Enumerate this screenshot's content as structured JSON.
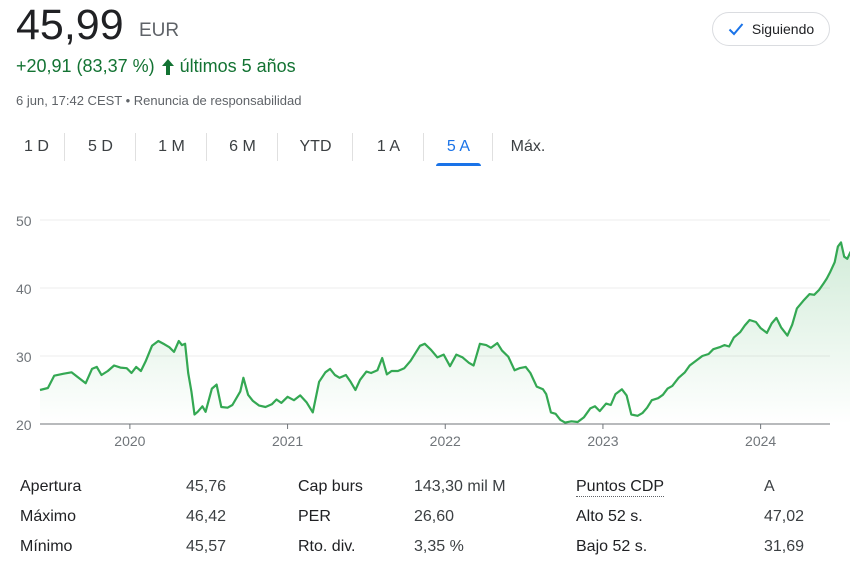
{
  "quote": {
    "price": "45,99",
    "currency": "EUR",
    "change": "+20,91 (83,37 %)",
    "period": "últimos 5 años",
    "timestamp": "6 jun, 17:42 CEST",
    "separator": " • ",
    "disclaimer": "Renuncia de responsabilidad"
  },
  "follow_button": {
    "label": "Siguiendo"
  },
  "tabs": [
    {
      "label": "1 D",
      "active": false
    },
    {
      "label": "5 D",
      "active": false
    },
    {
      "label": "1 M",
      "active": false
    },
    {
      "label": "6 M",
      "active": false
    },
    {
      "label": "YTD",
      "active": false
    },
    {
      "label": "1 A",
      "active": false
    },
    {
      "label": "5 A",
      "active": true
    },
    {
      "label": "Máx.",
      "active": false
    }
  ],
  "colors": {
    "up": "#137333",
    "line": "#34a853",
    "accent": "#1a73e8"
  },
  "chart_data": {
    "type": "area",
    "x_ticks": [
      "2020",
      "2021",
      "2022",
      "2023",
      "2024"
    ],
    "y_ticks": [
      "50",
      "40",
      "30",
      "20"
    ],
    "ylim": [
      20,
      50
    ],
    "xlim": [
      2019.43,
      2024.44
    ],
    "grid": true,
    "series": [
      {
        "values": [
          [
            2019.43,
            25.0
          ],
          [
            2019.48,
            25.3
          ],
          [
            2019.52,
            27.1
          ],
          [
            2019.58,
            27.4
          ],
          [
            2019.63,
            27.6
          ],
          [
            2019.68,
            26.7
          ],
          [
            2019.72,
            26.0
          ],
          [
            2019.76,
            28.1
          ],
          [
            2019.79,
            28.4
          ],
          [
            2019.82,
            27.2
          ],
          [
            2019.86,
            27.8
          ],
          [
            2019.9,
            28.6
          ],
          [
            2019.94,
            28.3
          ],
          [
            2019.98,
            28.2
          ],
          [
            2020.01,
            27.5
          ],
          [
            2020.04,
            28.4
          ],
          [
            2020.07,
            27.8
          ],
          [
            2020.1,
            29.2
          ],
          [
            2020.14,
            31.5
          ],
          [
            2020.18,
            32.2
          ],
          [
            2020.22,
            31.7
          ],
          [
            2020.25,
            31.3
          ],
          [
            2020.28,
            30.6
          ],
          [
            2020.31,
            32.2
          ],
          [
            2020.33,
            31.6
          ],
          [
            2020.35,
            31.8
          ],
          [
            2020.37,
            27.5
          ],
          [
            2020.39,
            24.8
          ],
          [
            2020.41,
            21.4
          ],
          [
            2020.43,
            21.8
          ],
          [
            2020.46,
            22.6
          ],
          [
            2020.48,
            21.8
          ],
          [
            2020.52,
            25.2
          ],
          [
            2020.55,
            25.8
          ],
          [
            2020.58,
            22.5
          ],
          [
            2020.62,
            22.4
          ],
          [
            2020.65,
            22.8
          ],
          [
            2020.7,
            24.8
          ],
          [
            2020.72,
            26.8
          ],
          [
            2020.75,
            24.3
          ],
          [
            2020.78,
            23.4
          ],
          [
            2020.82,
            22.7
          ],
          [
            2020.86,
            22.5
          ],
          [
            2020.9,
            22.9
          ],
          [
            2020.93,
            23.6
          ],
          [
            2020.96,
            23.1
          ],
          [
            2021.0,
            24.0
          ],
          [
            2021.04,
            23.5
          ],
          [
            2021.08,
            24.2
          ],
          [
            2021.12,
            23.2
          ],
          [
            2021.16,
            21.7
          ],
          [
            2021.2,
            26.2
          ],
          [
            2021.24,
            27.6
          ],
          [
            2021.27,
            28.1
          ],
          [
            2021.3,
            27.2
          ],
          [
            2021.33,
            26.8
          ],
          [
            2021.37,
            27.2
          ],
          [
            2021.4,
            26.2
          ],
          [
            2021.43,
            25.0
          ],
          [
            2021.46,
            26.5
          ],
          [
            2021.5,
            27.7
          ],
          [
            2021.53,
            27.5
          ],
          [
            2021.57,
            27.9
          ],
          [
            2021.6,
            29.7
          ],
          [
            2021.63,
            27.3
          ],
          [
            2021.66,
            27.8
          ],
          [
            2021.7,
            27.8
          ],
          [
            2021.74,
            28.2
          ],
          [
            2021.78,
            29.3
          ],
          [
            2021.81,
            30.4
          ],
          [
            2021.84,
            31.5
          ],
          [
            2021.87,
            31.8
          ],
          [
            2021.91,
            30.9
          ],
          [
            2021.95,
            29.8
          ],
          [
            2021.99,
            30.2
          ],
          [
            2022.03,
            28.5
          ],
          [
            2022.07,
            30.2
          ],
          [
            2022.11,
            29.8
          ],
          [
            2022.15,
            29.0
          ],
          [
            2022.18,
            28.6
          ],
          [
            2022.22,
            31.8
          ],
          [
            2022.26,
            31.6
          ],
          [
            2022.29,
            31.2
          ],
          [
            2022.33,
            31.9
          ],
          [
            2022.36,
            30.8
          ],
          [
            2022.4,
            29.9
          ],
          [
            2022.44,
            27.9
          ],
          [
            2022.47,
            28.2
          ],
          [
            2022.51,
            28.4
          ],
          [
            2022.54,
            27.5
          ],
          [
            2022.58,
            25.5
          ],
          [
            2022.62,
            25.1
          ],
          [
            2022.64,
            24.4
          ],
          [
            2022.67,
            21.7
          ],
          [
            2022.7,
            21.5
          ],
          [
            2022.73,
            20.6
          ],
          [
            2022.76,
            20.2
          ],
          [
            2022.8,
            20.4
          ],
          [
            2022.84,
            20.3
          ],
          [
            2022.88,
            21.0
          ],
          [
            2022.92,
            22.3
          ],
          [
            2022.95,
            22.6
          ],
          [
            2022.98,
            21.9
          ],
          [
            2023.02,
            23.0
          ],
          [
            2023.05,
            22.8
          ],
          [
            2023.08,
            24.4
          ],
          [
            2023.12,
            25.1
          ],
          [
            2023.15,
            24.2
          ],
          [
            2023.18,
            21.4
          ],
          [
            2023.22,
            21.2
          ],
          [
            2023.25,
            21.6
          ],
          [
            2023.28,
            22.4
          ],
          [
            2023.31,
            23.5
          ],
          [
            2023.35,
            23.8
          ],
          [
            2023.38,
            24.3
          ],
          [
            2023.41,
            25.2
          ],
          [
            2023.44,
            25.6
          ],
          [
            2023.48,
            26.8
          ],
          [
            2023.52,
            27.6
          ],
          [
            2023.55,
            28.6
          ],
          [
            2023.59,
            29.3
          ],
          [
            2023.63,
            30.0
          ],
          [
            2023.67,
            30.3
          ],
          [
            2023.7,
            31.0
          ],
          [
            2023.74,
            31.3
          ],
          [
            2023.77,
            31.6
          ],
          [
            2023.8,
            31.4
          ],
          [
            2023.83,
            32.7
          ],
          [
            2023.87,
            33.5
          ],
          [
            2023.9,
            34.5
          ],
          [
            2023.93,
            35.3
          ],
          [
            2023.97,
            35.0
          ],
          [
            2024.0,
            34.1
          ],
          [
            2024.04,
            33.4
          ],
          [
            2024.07,
            34.8
          ],
          [
            2024.1,
            35.6
          ],
          [
            2024.13,
            34.2
          ],
          [
            2024.17,
            33.0
          ],
          [
            2024.2,
            34.6
          ],
          [
            2024.23,
            37.0
          ],
          [
            2024.27,
            38.1
          ],
          [
            2024.31,
            39.1
          ],
          [
            2024.34,
            39.0
          ],
          [
            2024.37,
            39.7
          ],
          [
            2024.4,
            40.7
          ],
          [
            2024.42,
            41.4
          ],
          [
            2024.44,
            42.3
          ],
          [
            2024.47,
            43.8
          ],
          [
            2024.49,
            46.1
          ],
          [
            2024.51,
            46.7
          ],
          [
            2024.53,
            44.6
          ],
          [
            2024.55,
            44.3
          ],
          [
            2024.57,
            45.3
          ],
          [
            2024.59,
            43.2
          ],
          [
            2024.61,
            43.1
          ],
          [
            2024.63,
            43.7
          ],
          [
            2024.65,
            44.6
          ],
          [
            2024.67,
            43.8
          ],
          [
            2024.69,
            46.0
          ]
        ]
      }
    ]
  },
  "stats": [
    [
      {
        "label": "Apertura",
        "value": "45,76"
      },
      {
        "label": "Cap burs",
        "value": "143,30 mil M"
      },
      {
        "label": "Puntos CDP",
        "value": "A"
      }
    ],
    [
      {
        "label": "Máximo",
        "value": "46,42"
      },
      {
        "label": "PER",
        "value": "26,60"
      },
      {
        "label": "Alto 52 s.",
        "value": "47,02"
      }
    ],
    [
      {
        "label": "Mínimo",
        "value": "45,57"
      },
      {
        "label": "Rto. div.",
        "value": "3,35 %"
      },
      {
        "label": "Bajo 52 s.",
        "value": "31,69"
      }
    ]
  ]
}
